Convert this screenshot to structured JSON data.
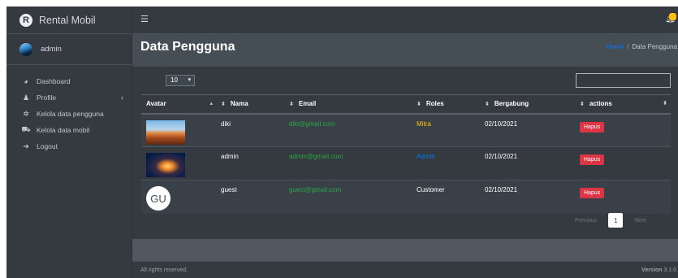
{
  "brand": {
    "logo_letter": "R",
    "name": "Rental Mobil"
  },
  "user": {
    "name": "admin"
  },
  "sidebar": {
    "items": [
      {
        "label": "Dashboard",
        "icon": "dashboard-icon"
      },
      {
        "label": "Profile",
        "icon": "user-icon",
        "caret": "‹"
      },
      {
        "label": "Kelola data pengguna",
        "icon": "users-icon"
      },
      {
        "label": "Kelola data mobil",
        "icon": "car-icon"
      },
      {
        "label": "Logout",
        "icon": "logout-icon"
      }
    ]
  },
  "topbar": {
    "menu_icon": "hamburger-icon",
    "notification_icon": "bell-icon"
  },
  "header": {
    "title": "Data Pengguna",
    "breadcrumb": {
      "home": "Home",
      "separator": "/",
      "current": "Data Pengguna"
    }
  },
  "table_controls": {
    "length_value": "10",
    "search_value": ""
  },
  "table": {
    "columns": [
      "Avatar",
      "Nama",
      "Email",
      "Roles",
      "Bergabung",
      "actions"
    ],
    "rows": [
      {
        "avatar": "desert",
        "nama": "diki",
        "email": "diki@gmail.com",
        "role": "Mitra",
        "bergabung": "02/10/2021",
        "action": "Hapus"
      },
      {
        "avatar": "jellyfish",
        "nama": "admin",
        "email": "admin@gmail.com",
        "role": "Admin",
        "bergabung": "02/10/2021",
        "action": "Hapus"
      },
      {
        "avatar": "GU",
        "nama": "guest",
        "email": "guest@gmail.com",
        "role": "Customer",
        "bergabung": "02/10/2021",
        "action": "Hapus"
      }
    ]
  },
  "pagination": {
    "previous": "Previous",
    "current_page": "1",
    "next": "Next"
  },
  "footer": {
    "left": "All rights reserved.",
    "version_label": "Version",
    "version_value": "3.1.0"
  },
  "colors": {
    "sidebar_bg": "#343a40",
    "content_bg": "#454d55",
    "accent_blue": "#007bff",
    "danger_red": "#dc3545",
    "success_green": "#28a745",
    "warning_yellow": "#ffc107"
  }
}
